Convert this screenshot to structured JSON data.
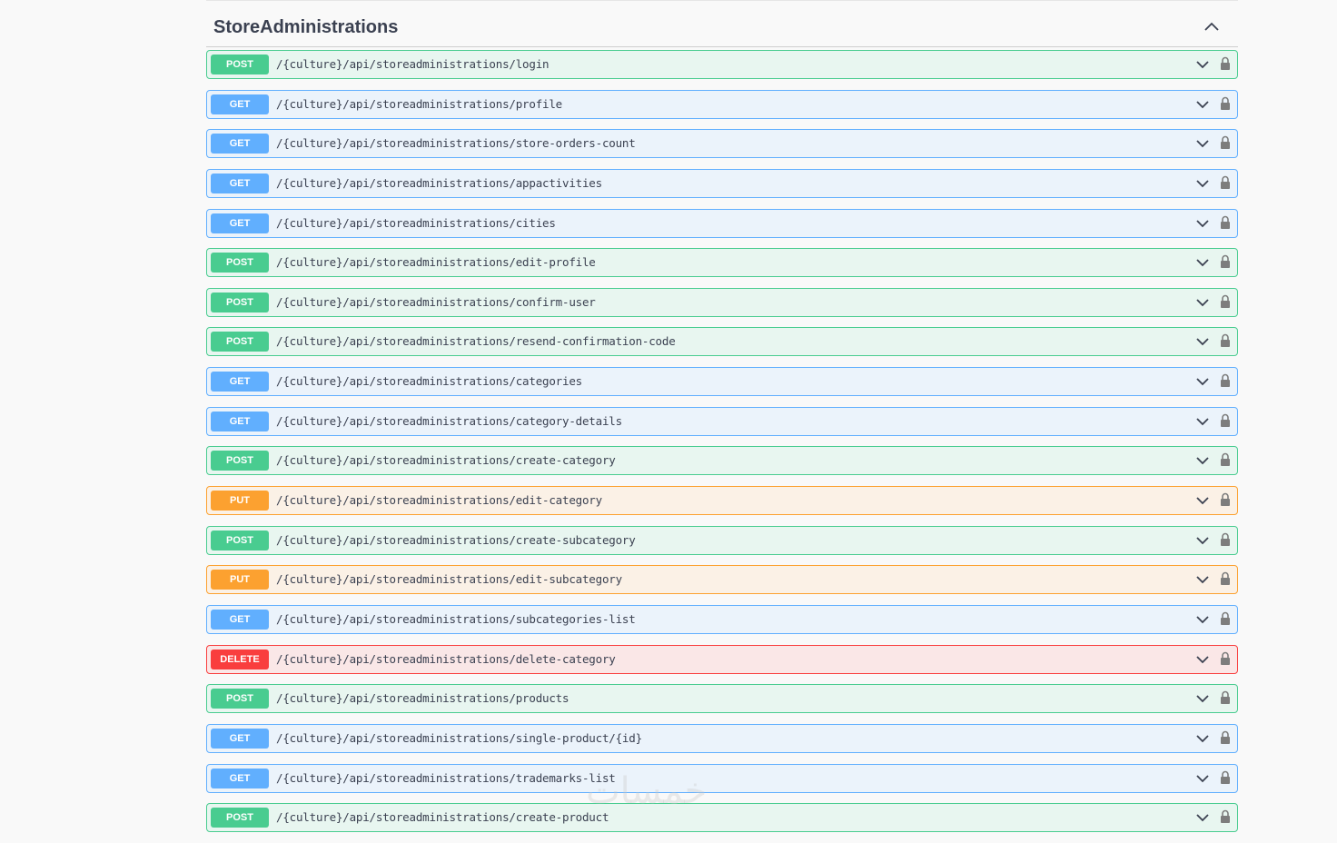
{
  "section": {
    "title": "StoreAdministrations",
    "toggle_icon": "chevron-up-icon"
  },
  "colors": {
    "get": "#61affe",
    "post": "#49cc90",
    "put": "#fca130",
    "delete": "#f93e3e"
  },
  "operations": [
    {
      "method": "POST",
      "path": "/{culture}/api/storeadministrations/login"
    },
    {
      "method": "GET",
      "path": "/{culture}/api/storeadministrations/profile"
    },
    {
      "method": "GET",
      "path": "/{culture}/api/storeadministrations/store-orders-count"
    },
    {
      "method": "GET",
      "path": "/{culture}/api/storeadministrations/appactivities"
    },
    {
      "method": "GET",
      "path": "/{culture}/api/storeadministrations/cities"
    },
    {
      "method": "POST",
      "path": "/{culture}/api/storeadministrations/edit-profile"
    },
    {
      "method": "POST",
      "path": "/{culture}/api/storeadministrations/confirm-user"
    },
    {
      "method": "POST",
      "path": "/{culture}/api/storeadministrations/resend-confirmation-code"
    },
    {
      "method": "GET",
      "path": "/{culture}/api/storeadministrations/categories"
    },
    {
      "method": "GET",
      "path": "/{culture}/api/storeadministrations/category-details"
    },
    {
      "method": "POST",
      "path": "/{culture}/api/storeadministrations/create-category"
    },
    {
      "method": "PUT",
      "path": "/{culture}/api/storeadministrations/edit-category"
    },
    {
      "method": "POST",
      "path": "/{culture}/api/storeadministrations/create-subcategory"
    },
    {
      "method": "PUT",
      "path": "/{culture}/api/storeadministrations/edit-subcategory"
    },
    {
      "method": "GET",
      "path": "/{culture}/api/storeadministrations/subcategories-list"
    },
    {
      "method": "DELETE",
      "path": "/{culture}/api/storeadministrations/delete-category"
    },
    {
      "method": "POST",
      "path": "/{culture}/api/storeadministrations/products"
    },
    {
      "method": "GET",
      "path": "/{culture}/api/storeadministrations/single-product/{id}"
    },
    {
      "method": "GET",
      "path": "/{culture}/api/storeadministrations/trademarks-list"
    },
    {
      "method": "POST",
      "path": "/{culture}/api/storeadministrations/create-product"
    }
  ],
  "watermark": "خمسات"
}
